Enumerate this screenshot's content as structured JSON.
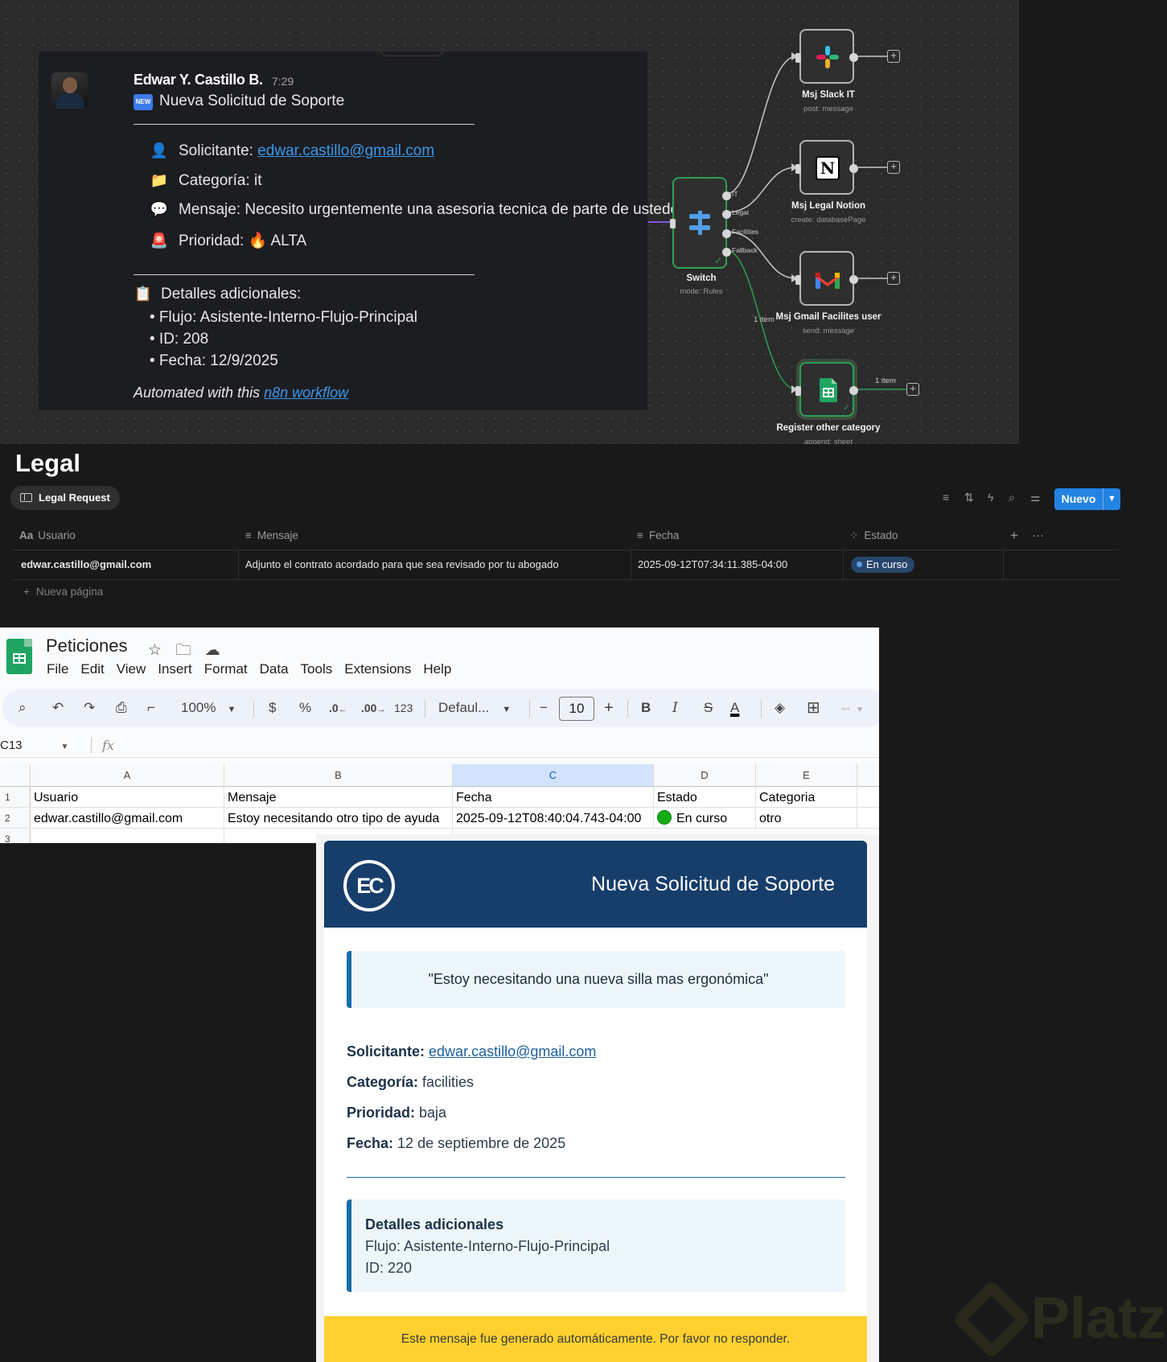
{
  "slack": {
    "author": "Edwar Y. Castillo B.",
    "time": "7:29",
    "new_badge": "NEW",
    "title": "Nueva Solicitud de Soporte",
    "solicitante_label": "Solicitante: ",
    "solicitante_email": "edwar.castillo@gmail.com",
    "categoria": "Categoría: it",
    "mensaje": "Mensaje: Necesito urgentemente una asesoria tecnica de parte de ustedes",
    "prioridad_label": "Prioridad: ",
    "prioridad_value": " ALTA",
    "detalles_title": "Detalles adicionales:",
    "bullets": [
      "• Flujo: Asistente-Interno-Flujo-Principal",
      "• ID: 208",
      "• Fecha: 12/9/2025"
    ],
    "footer_text": "Automated with this ",
    "footer_link": "n8n workflow"
  },
  "n8n": {
    "switch": {
      "title": "Switch",
      "sub": "mode: Rules",
      "outputs": [
        "IT",
        "Legal",
        "Facilities",
        "Fallback"
      ]
    },
    "nodes": [
      {
        "title": "Msj Slack IT",
        "sub": "post: message"
      },
      {
        "title": "Msj Legal Notion",
        "sub": "create: databasePage"
      },
      {
        "title": "Msj Gmail Facilites user",
        "sub": "send: message"
      },
      {
        "title": "Register other category",
        "sub": "append: sheet"
      }
    ],
    "edge_label_fallback": "1 item",
    "edge_label_sheet": "1 item",
    "colors": {
      "success": "#2f9e55",
      "switch_icon": "#4f9ee8"
    }
  },
  "notion": {
    "title": "Legal",
    "view_tab": "Legal Request",
    "new_button": "Nuevo",
    "columns": [
      "Usuario",
      "Mensaje",
      "Fecha",
      "Estado"
    ],
    "column_icons": [
      "Aa",
      "≡",
      "≡",
      "status-icon"
    ],
    "rows": [
      {
        "usuario": "edwar.castillo@gmail.com",
        "mensaje": "Adjunto el contrato acordado para que sea revisado por tu abogado",
        "fecha": "2025-09-12T07:34:11.385-04:00",
        "estado": "En curso"
      }
    ],
    "new_page": "Nueva página"
  },
  "sheets": {
    "title": "Peticiones",
    "menu": [
      "File",
      "Edit",
      "View",
      "Insert",
      "Format",
      "Data",
      "Tools",
      "Extensions",
      "Help"
    ],
    "zoom": "100%",
    "currency": "$",
    "percent": "%",
    "dec_less": ".0",
    "dec_more": ".00",
    "num_format": "123",
    "font": "Defaul...",
    "font_size": "10",
    "name_box": "C13",
    "fx": "fx",
    "col_headers": [
      "A",
      "B",
      "C",
      "D",
      "E"
    ],
    "row_numbers": [
      "1",
      "2",
      "3"
    ],
    "rows": [
      [
        "Usuario",
        "Mensaje",
        "Fecha",
        "Estado",
        "Categoria"
      ],
      [
        "edwar.castillo@gmail.com",
        "Estoy necesitando otro tipo de ayuda",
        "2025-09-12T08:40:04.743-04:00",
        "En curso",
        "otro"
      ]
    ]
  },
  "email": {
    "logo": "EC",
    "header_title": "Nueva Solicitud de Soporte",
    "quote": "\"Estoy necesitando una nueva silla mas ergonómica\"",
    "fields": [
      {
        "label": "Solicitante:",
        "value": "edwar.castillo@gmail.com"
      },
      {
        "label": "Categoría:",
        "value": "facilities"
      },
      {
        "label": "Prioridad:",
        "value": "baja"
      },
      {
        "label": "Fecha:",
        "value": "12 de septiembre de 2025"
      }
    ],
    "details_title": "Detalles adicionales",
    "details_flujo": "Flujo: Asistente-Interno-Flujo-Principal",
    "details_id": "ID: 220",
    "footer": "Este mensaje fue generado automáticamente. Por favor no responder.",
    "colors": {
      "header": "#173d6b",
      "accent": "#1a6ca8",
      "footer": "#fed130"
    }
  },
  "watermark": "Platzi"
}
